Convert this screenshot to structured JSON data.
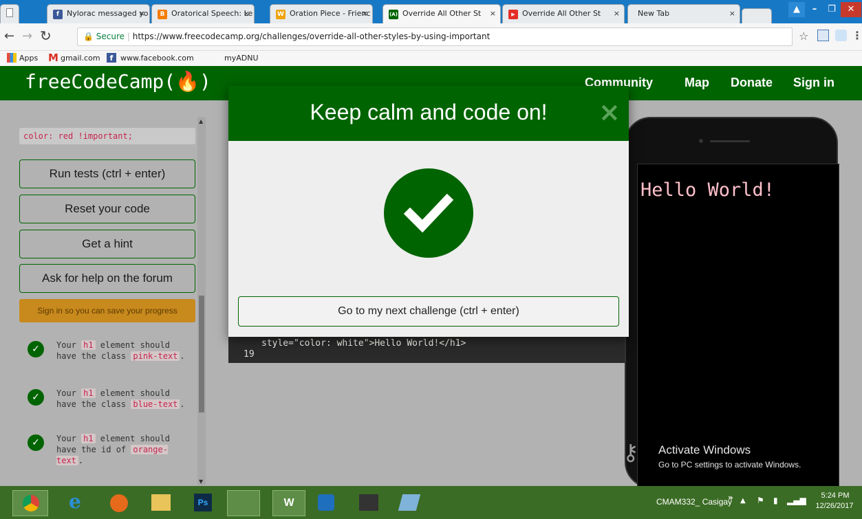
{
  "browser": {
    "tabs": [
      {
        "title": "Nylorac messaged yo",
        "icon": "facebook-icon",
        "color": "#3b5998",
        "glyph": "f"
      },
      {
        "title": "Oratorical Speech: Le",
        "icon": "blogger-icon",
        "color": "#f57d00",
        "glyph": "B"
      },
      {
        "title": "Oration Piece - Frienc",
        "icon": "scribd-icon",
        "color": "#f0a30a",
        "glyph": "W"
      },
      {
        "title": "Override All Other St",
        "icon": "freecodecamp-icon",
        "color": "#006400",
        "glyph": "(A)"
      },
      {
        "title": "Override All Other St",
        "icon": "youtube-icon",
        "color": "#e52d27",
        "glyph": "▶"
      },
      {
        "title": "New Tab",
        "icon": "",
        "color": "",
        "glyph": ""
      }
    ],
    "secure_label": "Secure",
    "url": "https://www.freecodecamp.org/challenges/override-all-other-styles-by-using-important",
    "bookmarks": [
      "Apps",
      "gmail.com",
      "www.facebook.com",
      "myADNU"
    ]
  },
  "fcc": {
    "logo": "freeCodeCamp(🔥)",
    "nav": [
      "Community",
      "Map",
      "Donate",
      "Sign in"
    ],
    "code_snippet": "color: red !important;",
    "buttons": [
      "Run tests (ctrl + enter)",
      "Reset your code",
      "Get a hint",
      "Ask for help on the forum"
    ],
    "signin_banner": "Sign in so you can save your progress",
    "tests": [
      {
        "pre": "Your ",
        "code1": "h1",
        "mid": " element should have the class ",
        "code2": "pink-text",
        "post": "."
      },
      {
        "pre": "Your ",
        "code1": "h1",
        "mid": " element should have the class ",
        "code2": "blue-text",
        "post": "."
      },
      {
        "pre": "Your ",
        "code1": "h1",
        "mid": " element should have the id of ",
        "code2": "orange-text",
        "post": "."
      }
    ],
    "editor_line": "style=\"color: white\">Hello World!</h1>",
    "editor_line_no": "19",
    "preview_text": "Hello World!"
  },
  "modal": {
    "title": "Keep calm and code on!",
    "close_glyph": "×",
    "next_button": "Go to my next challenge (ctrl + enter)"
  },
  "watermark": {
    "title": "Activate Windows",
    "subtitle": "Go to PC settings to activate Windows."
  },
  "taskbar": {
    "user": "CMAM332_ Casigay",
    "time": "5:24 PM",
    "date": "12/26/2017"
  }
}
